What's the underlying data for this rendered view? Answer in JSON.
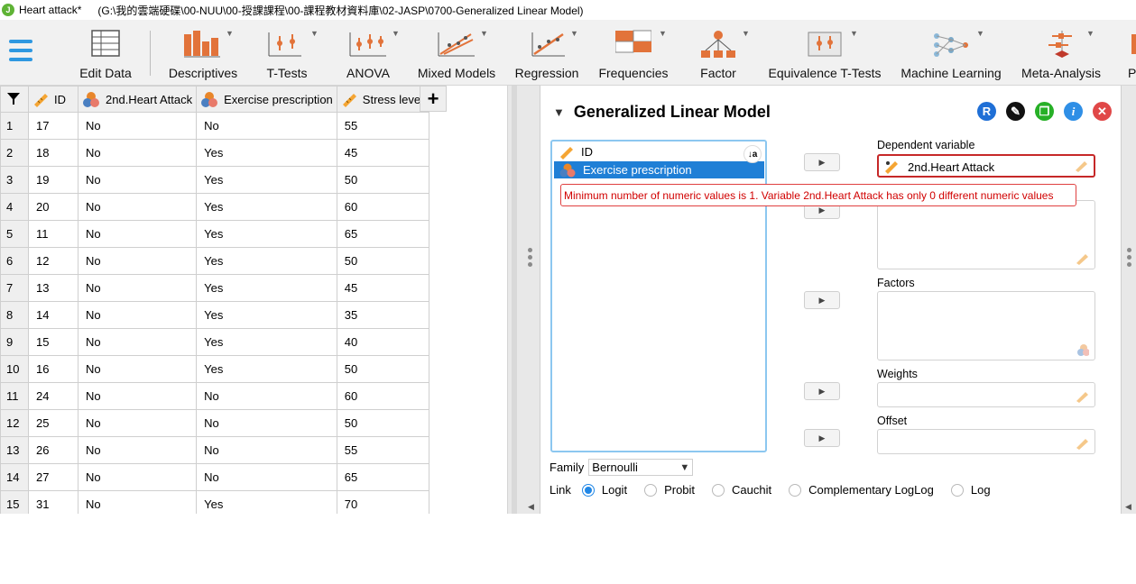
{
  "window": {
    "title": "Heart attack*",
    "path": "(G:\\我的雲端硬碟\\00-NUU\\00-授課課程\\00-課程教材資料庫\\02-JASP\\0700-Generalized Linear Model)"
  },
  "ribbon": {
    "items": [
      {
        "label": "Edit Data",
        "icon": "edit-data-icon"
      },
      {
        "label": "Descriptives",
        "icon": "descriptives-icon"
      },
      {
        "label": "T-Tests",
        "icon": "t-tests-icon"
      },
      {
        "label": "ANOVA",
        "icon": "anova-icon"
      },
      {
        "label": "Mixed Models",
        "icon": "mixed-models-icon"
      },
      {
        "label": "Regression",
        "icon": "regression-icon"
      },
      {
        "label": "Frequencies",
        "icon": "frequencies-icon"
      },
      {
        "label": "Factor",
        "icon": "factor-icon"
      },
      {
        "label": "Equivalence T-Tests",
        "icon": "equivalence-icon"
      },
      {
        "label": "Machine Learning",
        "icon": "machine-learning-icon"
      },
      {
        "label": "Meta-Analysis",
        "icon": "meta-analysis-icon"
      },
      {
        "label": "P",
        "icon": "more-icon"
      }
    ]
  },
  "grid": {
    "columns": [
      "ID",
      "2nd.Heart Attack",
      "Exercise prescription",
      "Stress level"
    ],
    "rows": [
      [
        "1",
        "17",
        "No",
        "No",
        "55"
      ],
      [
        "2",
        "18",
        "No",
        "Yes",
        "45"
      ],
      [
        "3",
        "19",
        "No",
        "Yes",
        "50"
      ],
      [
        "4",
        "20",
        "No",
        "Yes",
        "60"
      ],
      [
        "5",
        "11",
        "No",
        "Yes",
        "65"
      ],
      [
        "6",
        "12",
        "No",
        "Yes",
        "50"
      ],
      [
        "7",
        "13",
        "No",
        "Yes",
        "45"
      ],
      [
        "8",
        "14",
        "No",
        "Yes",
        "35"
      ],
      [
        "9",
        "15",
        "No",
        "Yes",
        "40"
      ],
      [
        "10",
        "16",
        "No",
        "Yes",
        "50"
      ],
      [
        "11",
        "24",
        "No",
        "No",
        "60"
      ],
      [
        "12",
        "25",
        "No",
        "No",
        "50"
      ],
      [
        "13",
        "26",
        "No",
        "No",
        "55"
      ],
      [
        "14",
        "27",
        "No",
        "No",
        "65"
      ],
      [
        "15",
        "31",
        "No",
        "Yes",
        "70"
      ]
    ]
  },
  "analysis": {
    "title": "Generalized Linear Model",
    "variables": [
      "ID",
      "Exercise prescription"
    ],
    "error_message": "Minimum number of numeric values is 1. Variable 2nd.Heart Attack has only 0 different numeric values",
    "dependent_label": "Dependent variable",
    "dependent_value": "2nd.Heart Attack",
    "factors_label": "Factors",
    "weights_label": "Weights",
    "offset_label": "Offset",
    "family_label": "Family",
    "family_value": "Bernoulli",
    "link_label": "Link",
    "link_options": [
      "Logit",
      "Probit",
      "Cauchit",
      "Complementary LogLog",
      "Log"
    ],
    "link_selected": "Logit",
    "header_icons": [
      "r-icon",
      "edit-icon",
      "duplicate-icon",
      "info-icon",
      "close-icon"
    ],
    "colors": {
      "r": "#1f6fd6",
      "edit": "#111111",
      "duplicate": "#27b027",
      "info": "#2f8fe6",
      "close": "#e04848",
      "error": "#c62828",
      "selected": "#1f7fd6"
    }
  }
}
